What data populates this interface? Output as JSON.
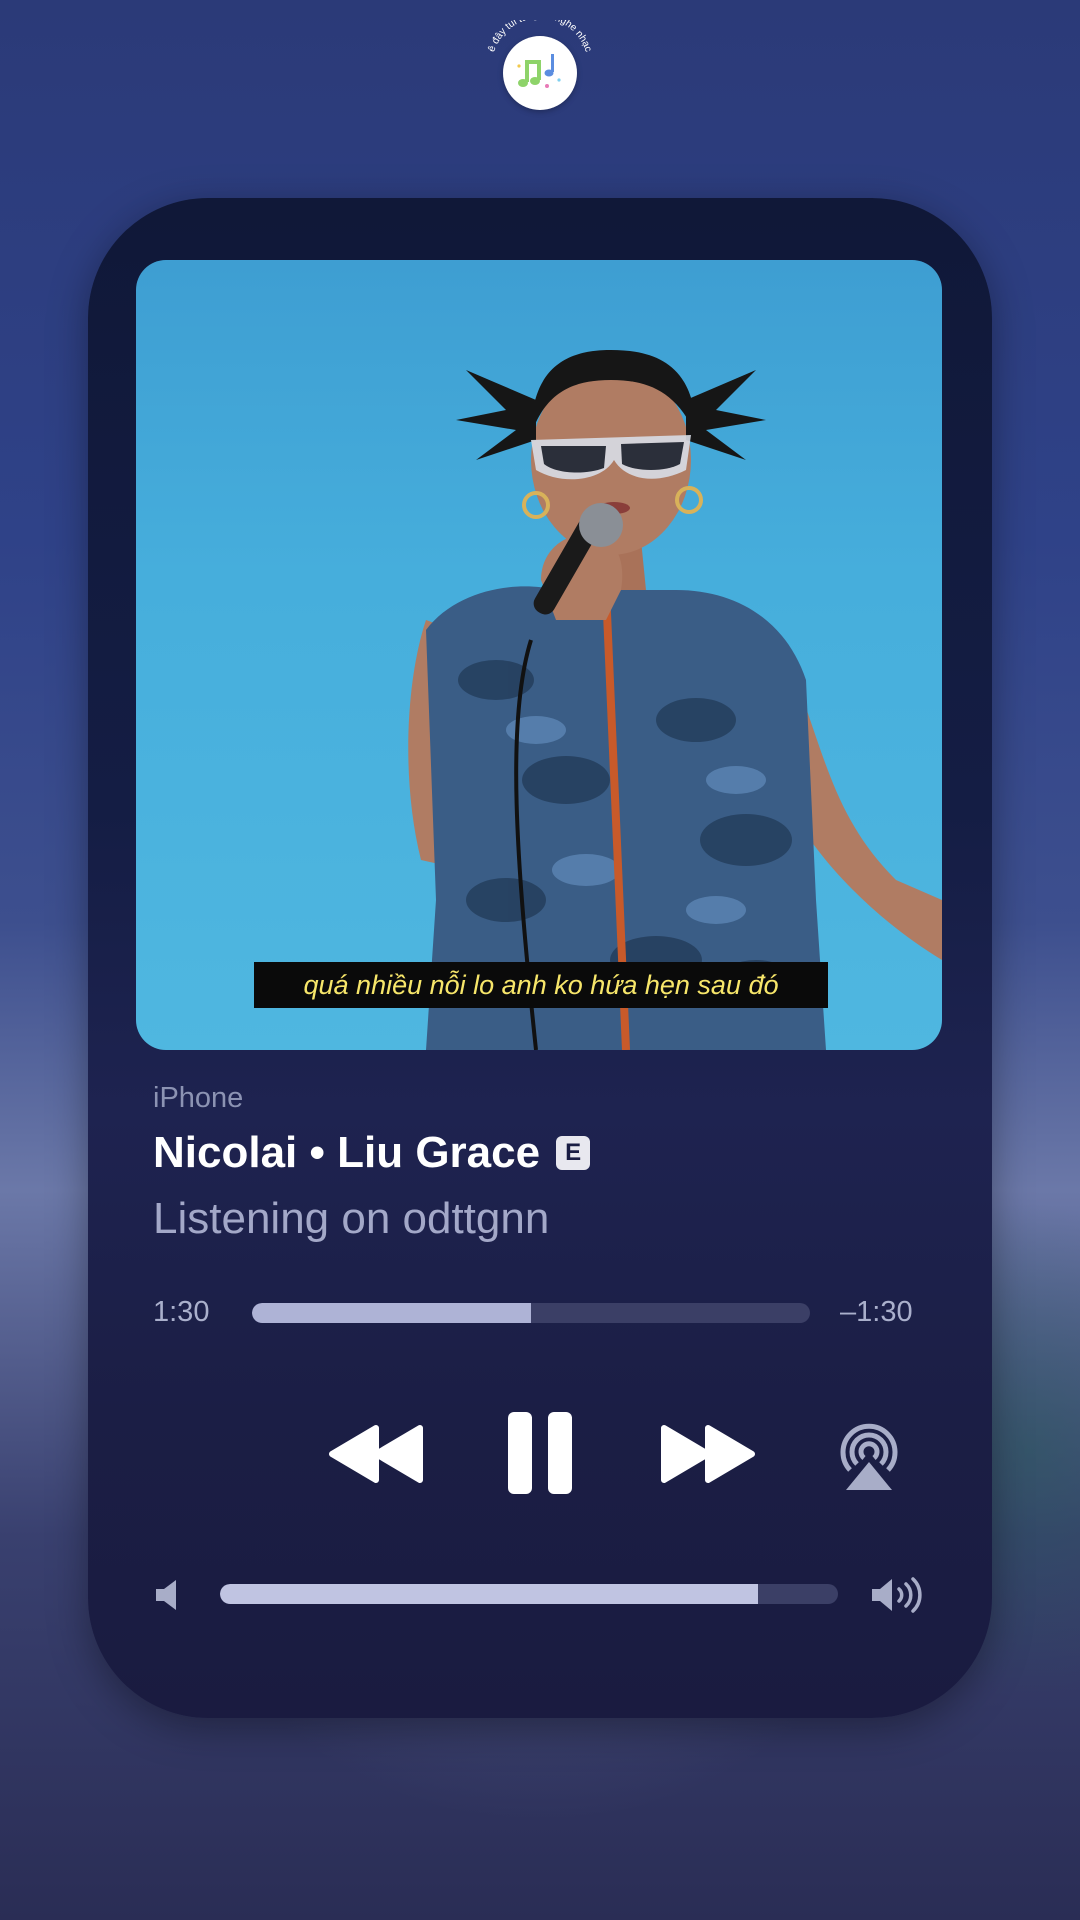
{
  "logo": {
    "text": "ê đây tui tui ghét nghe nhạc"
  },
  "video": {
    "subtitle": "quá nhiều nỗi lo anh ko hứa hẹn sau đó"
  },
  "player": {
    "device": "iPhone",
    "title": "Nicolai • Liu Grace",
    "explicit_badge": "E",
    "listening": "Listening on odttgnn",
    "elapsed": "1:30",
    "remaining": "–1:30",
    "progress_fraction": 0.5,
    "volume_fraction": 0.87
  },
  "icons": {
    "rewind": "rewind-icon",
    "pause": "pause-icon",
    "forward": "fast-forward-icon",
    "airplay": "airplay-icon",
    "volume_low": "speaker-low-icon",
    "volume_high": "speaker-high-icon"
  },
  "colors": {
    "background": "#2f4288",
    "card": "#141d44",
    "subtitle_text": "#f7e66a",
    "progress_fill": "#aeb3d6",
    "track": "#3b3f66"
  }
}
